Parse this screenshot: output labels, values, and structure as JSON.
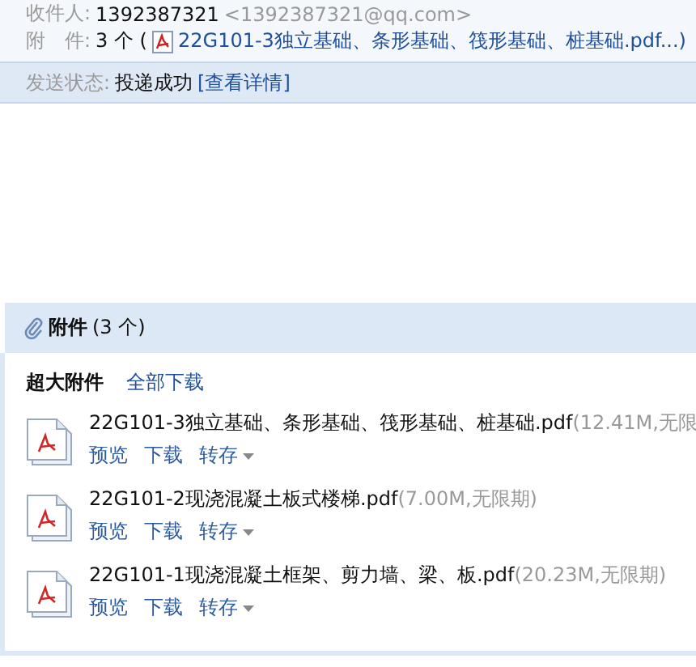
{
  "header": {
    "recipient_label": "收件人:",
    "recipient_name": "1392387321",
    "recipient_email": "<1392387321@qq.com>",
    "attach_label": "附　件:",
    "attach_count": "3 个 (",
    "attach_first": "22G101-3独立基础、条形基础、筏形基础、桩基础.pdf...)"
  },
  "status": {
    "label": "发送状态:",
    "value": "投递成功",
    "link": "[查看详情]"
  },
  "attachments": {
    "title": "附件",
    "count": "(3 个)",
    "group_label": "超大附件",
    "download_all": "全部下载",
    "files": [
      {
        "name": "22G101-3独立基础、条形基础、筏形基础、桩基础.pdf",
        "meta": "(12.41M,无限",
        "actions": [
          "预览",
          "下载",
          "转存"
        ]
      },
      {
        "name": "22G101-2现浇混凝土板式楼梯.pdf",
        "meta": "(7.00M,无限期)",
        "actions": [
          "预览",
          "下载",
          "转存"
        ]
      },
      {
        "name": "22G101-1现浇混凝土框架、剪力墙、梁、板.pdf",
        "meta": "(20.23M,无限期)",
        "actions": [
          "预览",
          "下载",
          "转存"
        ]
      }
    ]
  }
}
